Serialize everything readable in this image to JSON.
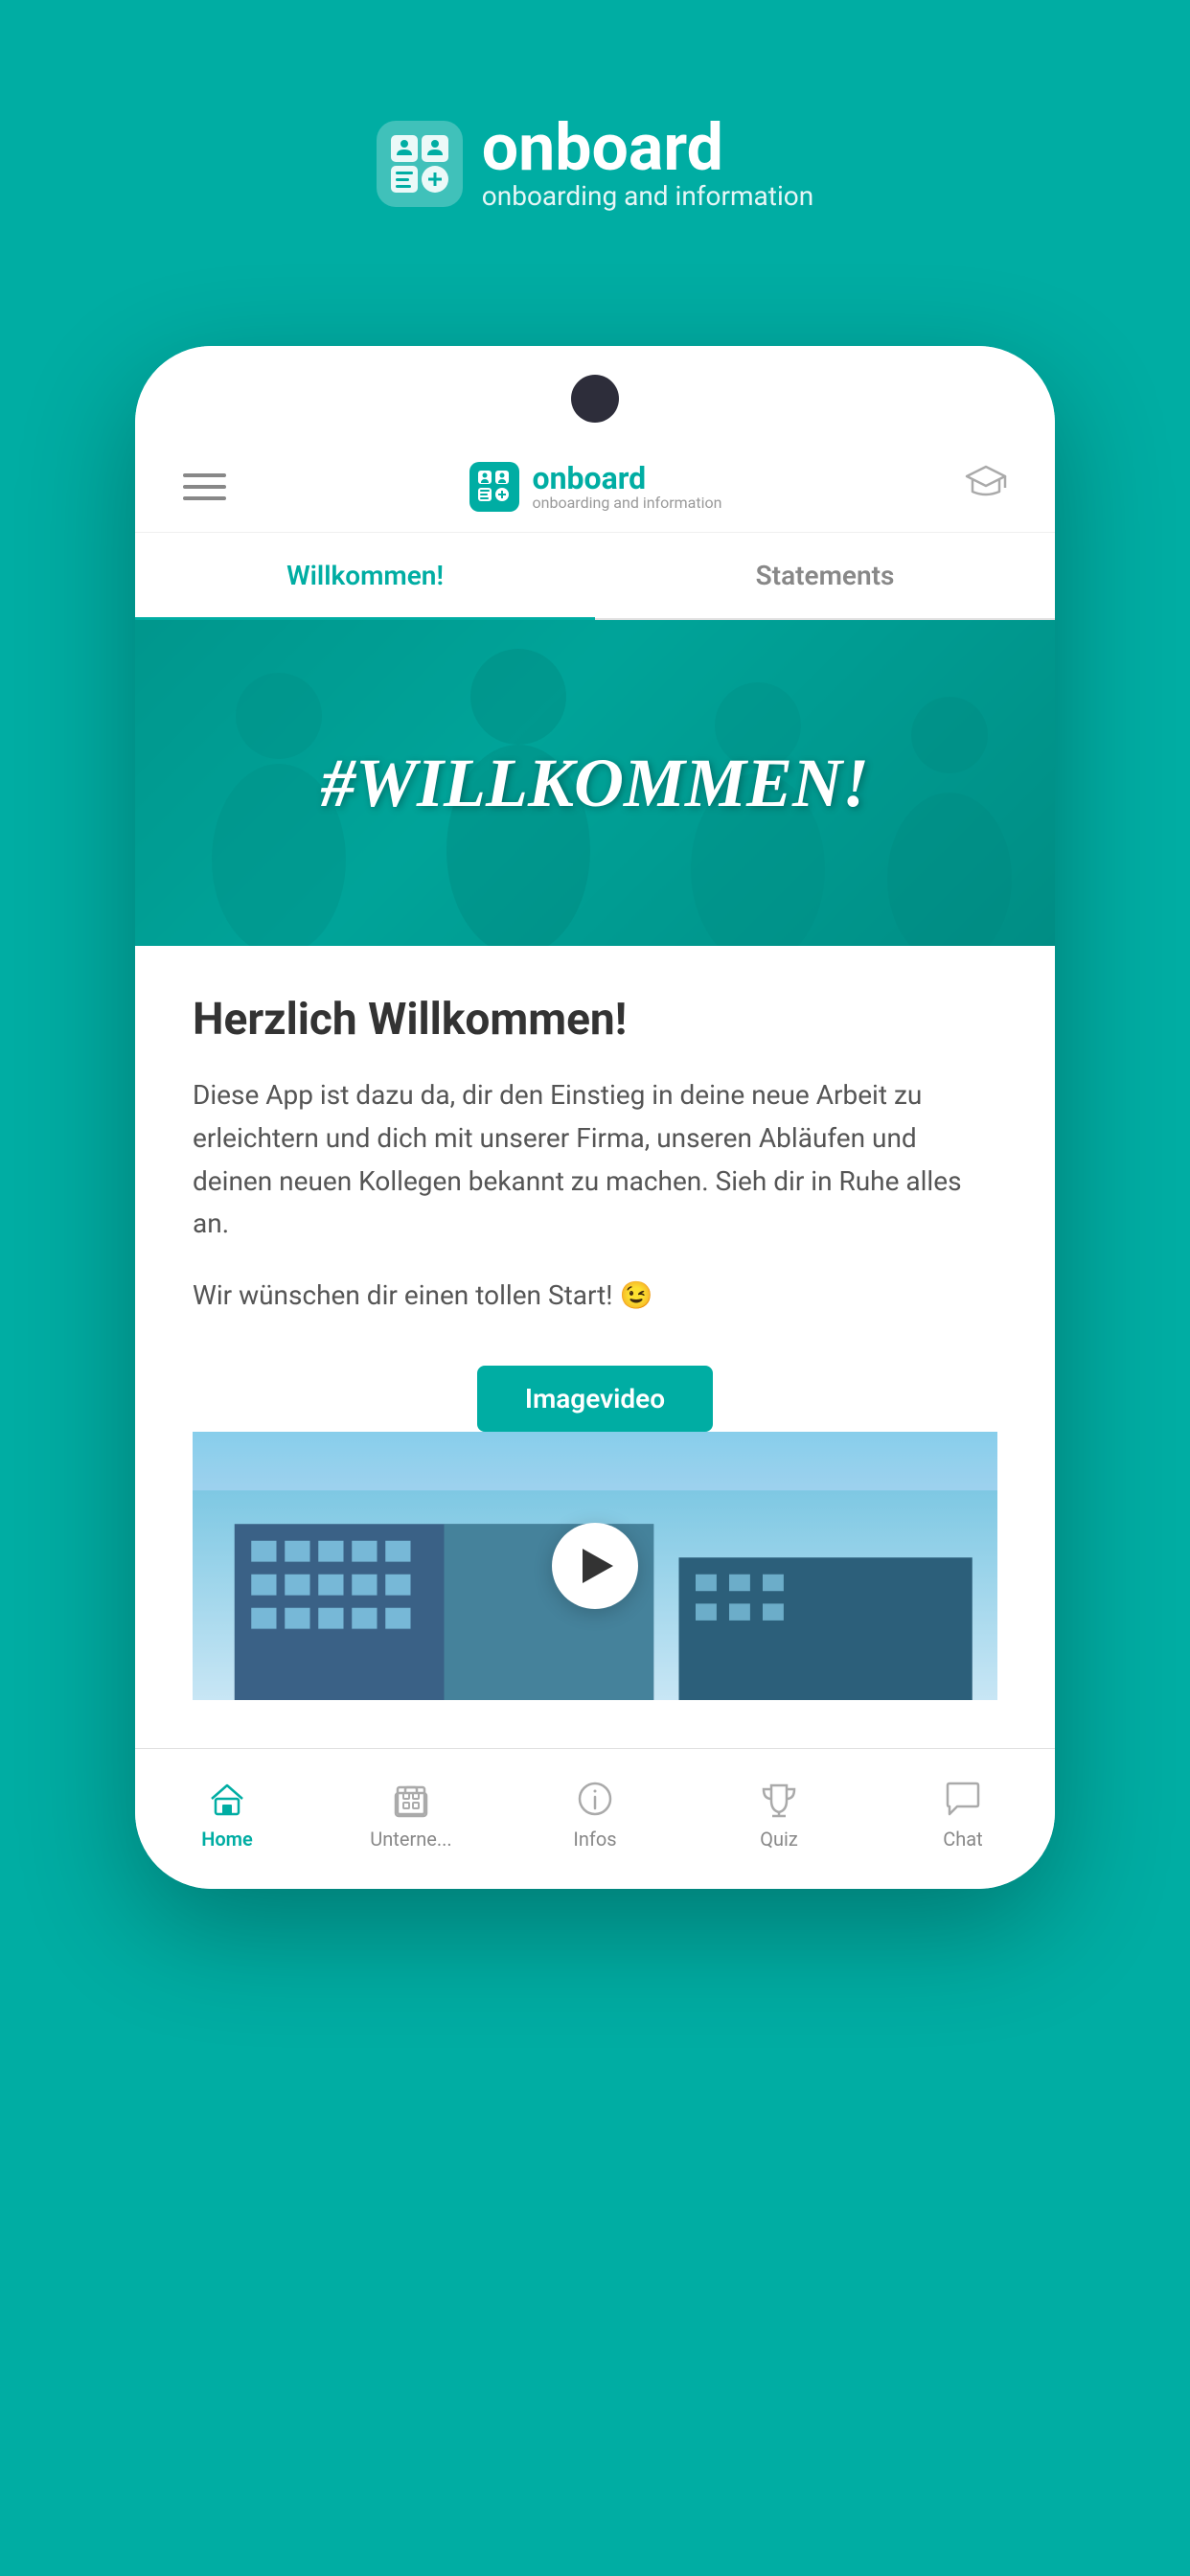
{
  "background_color": "#00ADA3",
  "header": {
    "logo_title": "onboard",
    "logo_subtitle": "onboarding and information"
  },
  "app": {
    "logo_title": "onboard",
    "logo_subtitle": "onboarding and information"
  },
  "tabs": [
    {
      "id": "willkommen",
      "label": "Willkommen!",
      "active": true
    },
    {
      "id": "statements",
      "label": "Statements",
      "active": false
    }
  ],
  "hero": {
    "text": "#WILLKOMMEN!"
  },
  "content": {
    "title": "Herzlich Willkommen!",
    "body": "Diese App ist dazu da, dir den Einstieg in deine neue Arbeit zu erleichtern und dich mit unserer Firma, unseren Abläufen und deinen neuen Kollegen bekannt zu machen. Sieh dir in Ruhe alles an.",
    "welcome_line": "Wir wünschen dir einen tollen Start! 😉"
  },
  "video": {
    "label": "Imagevideo"
  },
  "bottom_nav": [
    {
      "id": "home",
      "label": "Home",
      "icon": "home",
      "active": true
    },
    {
      "id": "unternehmen",
      "label": "Unterne...",
      "icon": "building",
      "active": false
    },
    {
      "id": "infos",
      "label": "Infos",
      "icon": "info",
      "active": false
    },
    {
      "id": "quiz",
      "label": "Quiz",
      "icon": "quiz",
      "active": false
    },
    {
      "id": "chat",
      "label": "Chat",
      "icon": "chat",
      "active": false
    }
  ]
}
